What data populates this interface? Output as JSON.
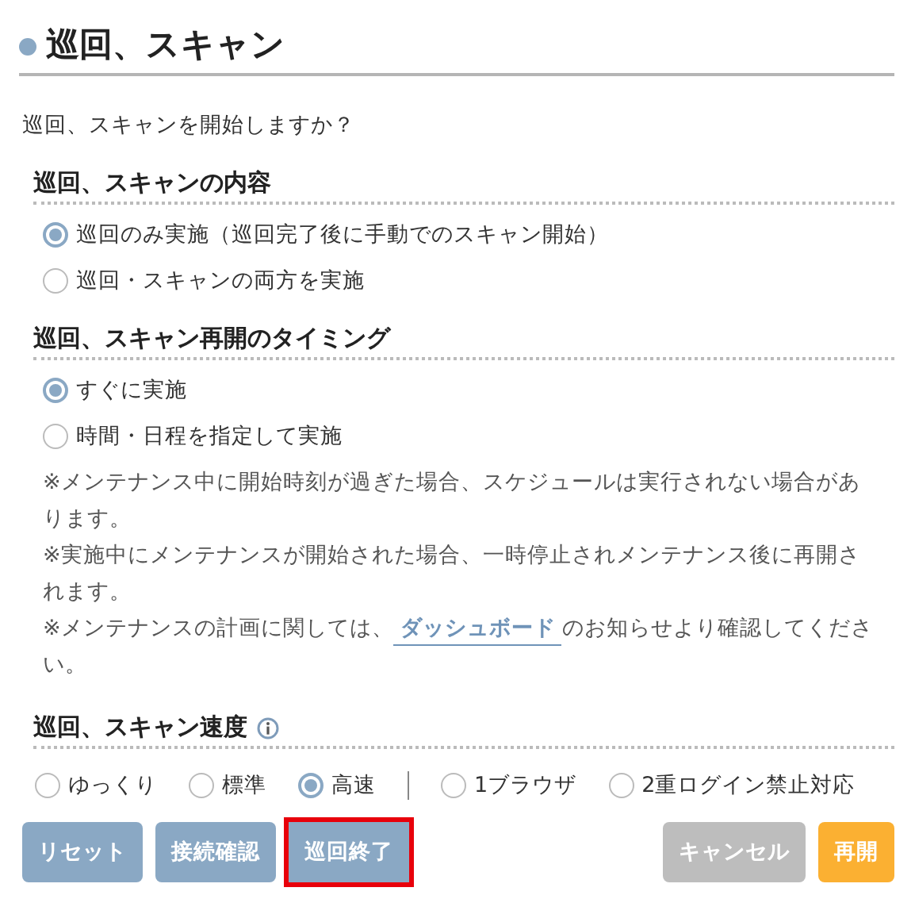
{
  "title": "巡回、スキャン",
  "prompt": "巡回、スキャンを開始しますか？",
  "sections": [
    {
      "heading": "巡回、スキャンの内容",
      "info": false,
      "inline": false,
      "options": [
        {
          "label": "巡回のみ実施（巡回完了後に手動でのスキャン開始）",
          "selected": true
        },
        {
          "label": "巡回・スキャンの両方を実施",
          "selected": false
        }
      ]
    },
    {
      "heading": "巡回、スキャン再開のタイミング",
      "info": false,
      "inline": false,
      "options": [
        {
          "label": "すぐに実施",
          "selected": true
        },
        {
          "label": "時間・日程を指定して実施",
          "selected": false
        }
      ],
      "notes": [
        {
          "text": "※メンテナンス中に開始時刻が過ぎた場合、スケジュールは実行されない場合があります。"
        },
        {
          "text": "※実施中にメンテナンスが開始された場合、一時停止されメンテナンス後に再開されます。"
        },
        {
          "text": "※メンテナンスの計画に関しては、",
          "link": "ダッシュボード",
          "after": "のお知らせより確認してください。"
        }
      ]
    },
    {
      "heading": "巡回、スキャン速度",
      "info": true,
      "inline": true,
      "options": [
        {
          "label": "ゆっくり",
          "selected": false
        },
        {
          "label": "標準",
          "selected": false
        },
        {
          "label": "高速",
          "selected": true
        }
      ],
      "options2": [
        {
          "label": "1ブラウザ",
          "selected": false
        },
        {
          "label": "2重ログイン禁止対応",
          "selected": false
        }
      ]
    }
  ],
  "buttons_left": [
    {
      "label": "リセット",
      "kind": "primary",
      "highlighted": false
    },
    {
      "label": "接続確認",
      "kind": "primary",
      "highlighted": false
    },
    {
      "label": "巡回終了",
      "kind": "primary",
      "highlighted": true
    }
  ],
  "buttons_right": [
    {
      "label": "キャンセル",
      "kind": "secondary",
      "highlighted": false
    },
    {
      "label": "再開",
      "kind": "accent",
      "highlighted": false
    }
  ]
}
